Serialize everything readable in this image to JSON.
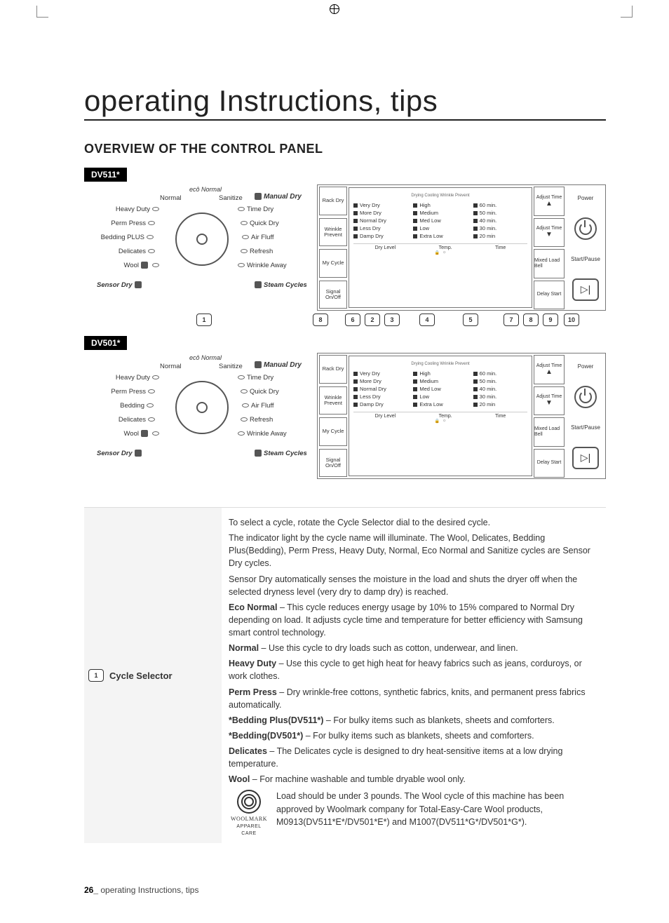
{
  "chapter_title": "operating Instructions, tips",
  "section_title": "OVERVIEW OF THE CONTROL PANEL",
  "models": {
    "a": "DV511*",
    "b": "DV501*"
  },
  "dial": {
    "top_left": "Normal",
    "top_center": "ecȏ Normal",
    "top_right": "Sanitize",
    "manual": "Manual Dry",
    "left": [
      "Heavy Duty",
      "Perm Press",
      "Bedding PLUS",
      "Delicates",
      "Wool"
    ],
    "left_b": [
      "Heavy Duty",
      "Perm Press",
      "Bedding",
      "Delicates",
      "Wool"
    ],
    "right": [
      "Time Dry",
      "Quick Dry",
      "Air Fluff",
      "Refresh",
      "Wrinkle Away"
    ],
    "bottom_left": "Sensor Dry",
    "bottom_right": "Steam Cycles"
  },
  "display": {
    "side_left": [
      "Rack Dry",
      "Wrinkle Prevent",
      "My Cycle",
      "Signal On/Off"
    ],
    "top": "Drying  Cooling  Wrinkle Prevent",
    "col1": [
      "Very Dry",
      "More Dry",
      "Normal Dry",
      "Less Dry",
      "Damp Dry"
    ],
    "col2": [
      "High",
      "Medium",
      "Med Low",
      "Low",
      "Extra Low"
    ],
    "col3": [
      "60 min.",
      "50 min.",
      "40 min.",
      "30 min.",
      "20 min"
    ],
    "footer": [
      "Dry Level",
      "Temp.",
      "Time"
    ],
    "side_right": [
      {
        "l1": "Adjust Time",
        "arrow": "▲"
      },
      {
        "l1": "Adjust Time",
        "arrow": "▼"
      },
      {
        "l1": "Mixed Load Bell",
        "arrow": ""
      },
      {
        "l1": "Delay Start",
        "arrow": ""
      }
    ],
    "power": "Power",
    "start": "Start/Pause"
  },
  "callouts_a": [
    "1",
    "8",
    "6",
    "2",
    "3",
    "4",
    "5",
    "7",
    "8",
    "9",
    "10"
  ],
  "desc": {
    "num": "1",
    "title": "Cycle Selector",
    "p1": "To select a cycle, rotate the Cycle Selector dial to the desired cycle.",
    "p2": "The indicator light by the cycle name will illuminate. The Wool, Delicates, Bedding Plus(Bedding), Perm Press, Heavy Duty, Normal, Eco Normal and Sanitize cycles are Sensor Dry cycles.",
    "p3": "Sensor Dry automatically senses the moisture in the load and shuts the dryer off when the selected dryness level (very dry to damp dry) is reached.",
    "eco_b": "Eco Normal",
    "eco_t": " – This cycle reduces energy usage by 10% to 15% compared to Normal Dry depending on load. It adjusts cycle time  and temperature for better efficiency with Samsung smart control technology.",
    "normal_b": "Normal",
    "normal_t": " – Use this cycle to dry loads such as cotton, underwear, and linen.",
    "heavy_b": "Heavy Duty",
    "heavy_t": " – Use this cycle to get high heat for heavy fabrics such as jeans, corduroys, or work clothes.",
    "perm_b": "Perm Press",
    "perm_t": " – Dry wrinkle-free cottons, synthetic fabrics, knits, and permanent press fabrics automatically.",
    "bed511_b": "*Bedding Plus(DV511*)",
    "bed511_t": " – For bulky items such as blankets, sheets and comforters.",
    "bed501_b": "*Bedding(DV501*)",
    "bed501_t": " – For bulky items such as blankets, sheets and comforters.",
    "del_b": "Delicates",
    "del_t": " – The Delicates cycle is designed to dry heat-sensitive items at a low drying temperature.",
    "wool_b": "Wool",
    "wool_t": " – For machine washable and tumble dryable wool only.",
    "wool_badge1": "WOOLMARK",
    "wool_badge2": "APPAREL CARE",
    "wool_note": "Load should be under 3 pounds. The Wool cycle of  this machine has been approved by Woolmark company for Total-Easy-Care Wool products, M0913(DV511*E*/DV501*E*) and M1007(DV511*G*/DV501*G*)."
  },
  "footer": {
    "page": "26_",
    "text": " operating Instructions, tips"
  }
}
